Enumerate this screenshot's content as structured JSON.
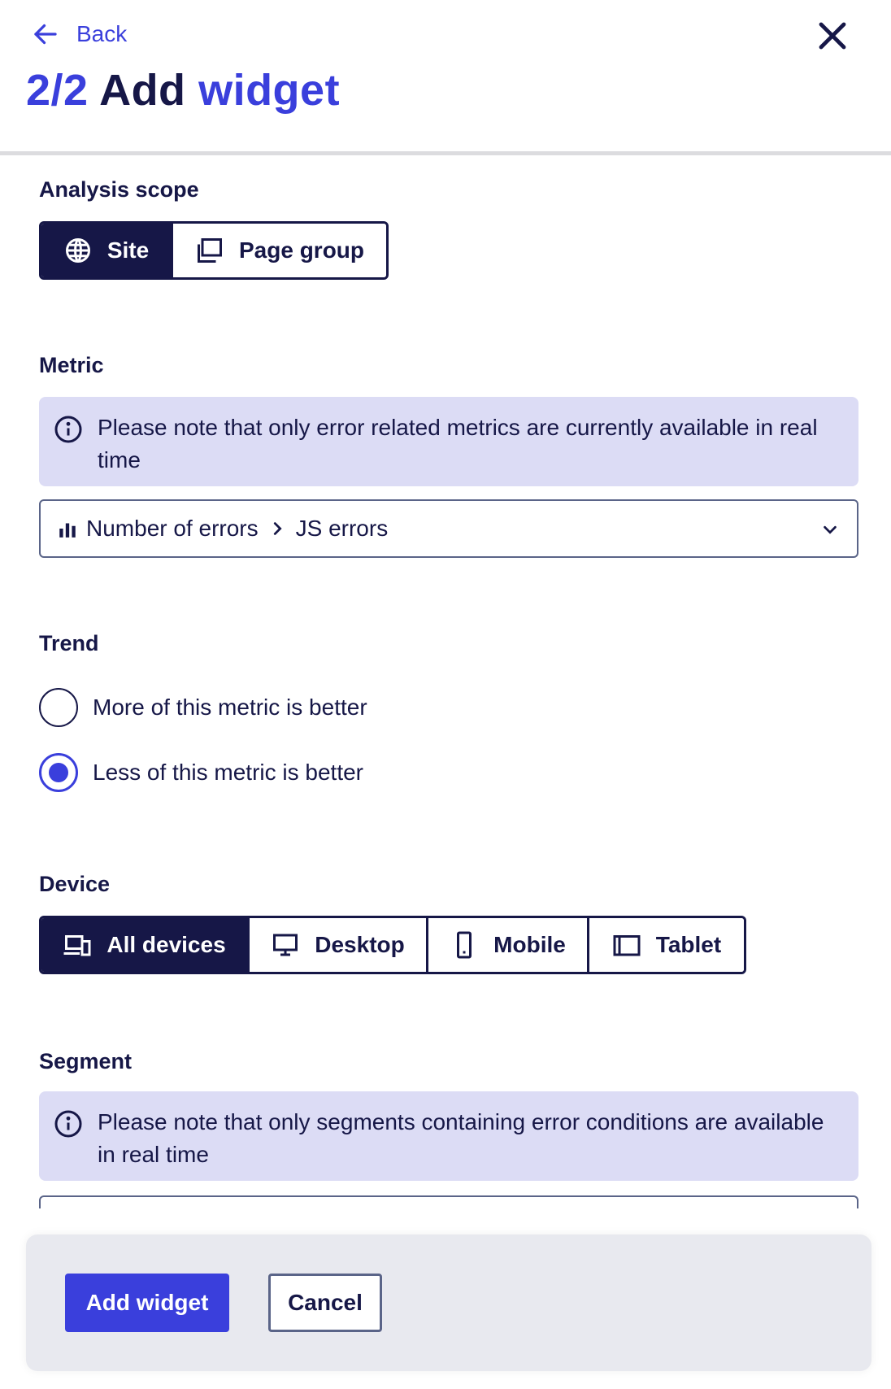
{
  "header": {
    "back_label": "Back",
    "step": "2/2",
    "title_word1": "Add",
    "title_word2": "widget"
  },
  "analysis_scope": {
    "label": "Analysis scope",
    "options": [
      {
        "label": "Site",
        "icon": "globe-icon",
        "selected": true
      },
      {
        "label": "Page group",
        "icon": "pages-icon",
        "selected": false
      }
    ]
  },
  "metric": {
    "label": "Metric",
    "info": "Please note that only error related metrics are currently available in real time",
    "selected_category": "Number of errors",
    "selected_value": "JS errors"
  },
  "trend": {
    "label": "Trend",
    "options": [
      {
        "label": "More of this metric is better",
        "checked": false
      },
      {
        "label": "Less of this metric is better",
        "checked": true
      }
    ]
  },
  "device": {
    "label": "Device",
    "options": [
      {
        "label": "All devices",
        "icon": "devices-icon",
        "selected": true
      },
      {
        "label": "Desktop",
        "icon": "desktop-icon",
        "selected": false
      },
      {
        "label": "Mobile",
        "icon": "mobile-icon",
        "selected": false
      },
      {
        "label": "Tablet",
        "icon": "tablet-icon",
        "selected": false
      }
    ]
  },
  "segment": {
    "label": "Segment",
    "info": "Please note that only segments containing error conditions are available in real time"
  },
  "footer": {
    "primary_label": "Add widget",
    "secondary_label": "Cancel"
  },
  "colors": {
    "accent": "#3a3fdc",
    "dark": "#161747",
    "info_bg": "#dcdcf5"
  }
}
